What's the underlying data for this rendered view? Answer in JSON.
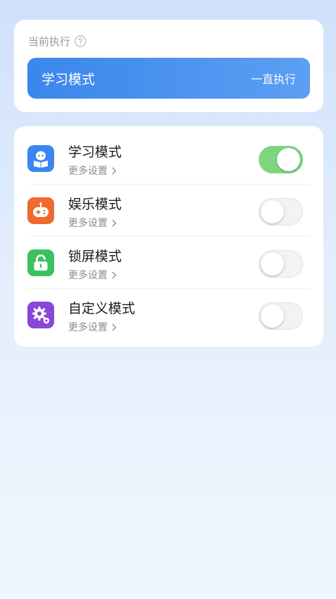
{
  "current": {
    "label": "当前执行",
    "mode": "学习模式",
    "duration": "一直执行"
  },
  "modes": [
    {
      "title": "学习模式",
      "more": "更多设置",
      "icon": "study-icon",
      "color": "#3a86ee",
      "enabled": true
    },
    {
      "title": "娱乐模式",
      "more": "更多设置",
      "icon": "gamepad-icon",
      "color": "#f06a2e",
      "enabled": false
    },
    {
      "title": "锁屏模式",
      "more": "更多设置",
      "icon": "lock-icon",
      "color": "#3cc160",
      "enabled": false
    },
    {
      "title": "自定义模式",
      "more": "更多设置",
      "icon": "gear-icon",
      "color": "#8a46d6",
      "enabled": false
    }
  ],
  "colors": {
    "accent": "#3b86ec",
    "toggle_on": "#7fd57e"
  }
}
